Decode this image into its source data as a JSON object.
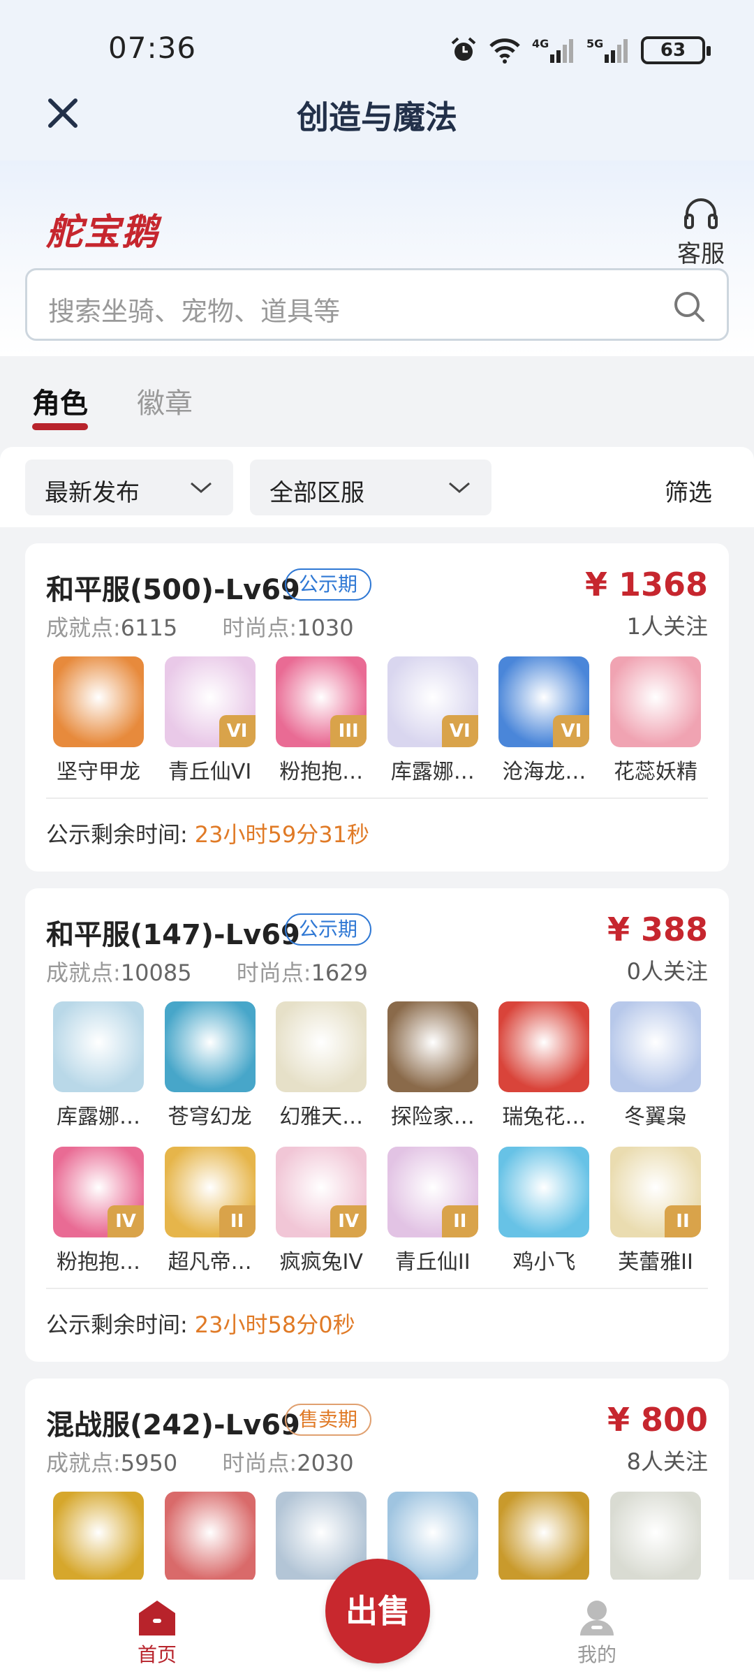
{
  "status": {
    "time": "07:36",
    "battery": "63",
    "net1": "4G",
    "net2": "5G"
  },
  "nav": {
    "title": "创造与魔法"
  },
  "brand": {
    "logo": "舵宝鹅",
    "service_label": "客服"
  },
  "search": {
    "placeholder": "搜索坐骑、宠物、道具等"
  },
  "tabs": [
    {
      "label": "角色"
    },
    {
      "label": "徽章"
    }
  ],
  "filters": {
    "sort": "最新发布",
    "region": "全部区服",
    "filter": "筛选"
  },
  "listings": [
    {
      "title": "和平服(500)-Lv69",
      "badge": "公示期",
      "price": "¥ 1368",
      "follow": "1人关注",
      "achievement_label": "成就点:",
      "achievement": "6115",
      "fashion_label": "时尚点:",
      "fashion": "1030",
      "remain_label": "公示剩余时间:",
      "remain_time": "23小时59分31秒",
      "items": [
        {
          "name": "坚守甲龙",
          "color": "#e78a3c",
          "roman": ""
        },
        {
          "name": "青丘仙VI",
          "color": "#e9c9e8",
          "roman": "VI"
        },
        {
          "name": "粉抱抱…",
          "color": "#e96b94",
          "roman": "III"
        },
        {
          "name": "库露娜…",
          "color": "#d9d6ef",
          "roman": "VI"
        },
        {
          "name": "沧海龙…",
          "color": "#4a86d9",
          "roman": "VI"
        },
        {
          "name": "花蕊妖精",
          "color": "#f0a3b2",
          "roman": ""
        }
      ]
    },
    {
      "title": "和平服(147)-Lv69",
      "badge": "公示期",
      "price": "¥ 388",
      "follow": "0人关注",
      "achievement_label": "成就点:",
      "achievement": "10085",
      "fashion_label": "时尚点:",
      "fashion": "1629",
      "remain_label": "公示剩余时间:",
      "remain_time": "23小时58分0秒",
      "items": [
        {
          "name": "库露娜…",
          "color": "#b9d8e8",
          "roman": ""
        },
        {
          "name": "苍穹幻龙",
          "color": "#47a6c9",
          "roman": ""
        },
        {
          "name": "幻雅天…",
          "color": "#e6e0c8",
          "roman": ""
        },
        {
          "name": "探险家…",
          "color": "#8a6a4a",
          "roman": ""
        },
        {
          "name": "瑞兔花…",
          "color": "#d9443a",
          "roman": ""
        },
        {
          "name": "冬翼枭",
          "color": "#b7c8ea",
          "roman": ""
        },
        {
          "name": "粉抱抱…",
          "color": "#e96b94",
          "roman": "IV"
        },
        {
          "name": "超凡帝…",
          "color": "#e6b54a",
          "roman": "II"
        },
        {
          "name": "疯疯兔IV",
          "color": "#f1c6d6",
          "roman": "IV"
        },
        {
          "name": "青丘仙II",
          "color": "#e2c3e4",
          "roman": "II"
        },
        {
          "name": "鸡小飞",
          "color": "#67c2e6",
          "roman": ""
        },
        {
          "name": "芙蕾雅II",
          "color": "#eadcb0",
          "roman": "II"
        }
      ]
    },
    {
      "title": "混战服(242)-Lv69",
      "badge": "售卖期",
      "price": "¥ 800",
      "follow": "8人关注",
      "achievement_label": "成就点:",
      "achievement": "5950",
      "fashion_label": "时尚点:",
      "fashion": "2030",
      "items": [
        {
          "name": "",
          "color": "#d6a72c",
          "roman": ""
        },
        {
          "name": "",
          "color": "#d96a6a",
          "roman": ""
        },
        {
          "name": "",
          "color": "#b3c5d6",
          "roman": ""
        },
        {
          "name": "",
          "color": "#9fc4e0",
          "roman": ""
        },
        {
          "name": "",
          "color": "#c99a2c",
          "roman": ""
        },
        {
          "name": "",
          "color": "#d9dbd2",
          "roman": ""
        }
      ]
    }
  ],
  "bottom": {
    "home": "首页",
    "sell": "出售",
    "mine": "我的"
  }
}
